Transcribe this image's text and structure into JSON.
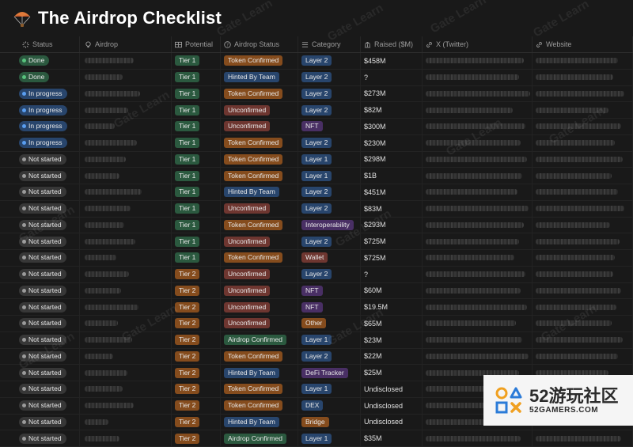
{
  "page": {
    "title": "The Airdrop Checklist"
  },
  "columns": {
    "status": "Status",
    "airdrop": "Airdrop",
    "potential": "Potential",
    "airdrop_status": "Airdrop Status",
    "category": "Category",
    "raised": "Raised ($M)",
    "x": "X (Twitter)",
    "website": "Website"
  },
  "colors": {
    "done": "#2b593f",
    "in_progress": "#28456c",
    "not_started": "#373737",
    "tier1": "#2b593f",
    "tier2": "#854c1d",
    "confirmed_brown": "#854c1d",
    "hinted_blue": "#28456c",
    "unconfirmed_red": "#6e3630",
    "airdrop_confirmed_green": "#2b593f",
    "layer_blue": "#28456c",
    "nft_purple": "#492f64",
    "wallet_red": "#6e3630",
    "other_brown": "#854c1d",
    "defi_purple": "#492f64",
    "bridge_brown": "#854c1d",
    "dex_blue": "#28456c"
  },
  "rows": [
    {
      "status": "Done",
      "potential": "Tier 1",
      "airdrop_status": "Token Confirmed",
      "category": "Layer 2",
      "raised": "$458M"
    },
    {
      "status": "Done",
      "potential": "Tier 1",
      "airdrop_status": "Hinted By Team",
      "category": "Layer 2",
      "raised": "?"
    },
    {
      "status": "In progress",
      "potential": "Tier 1",
      "airdrop_status": "Token Confirmed",
      "category": "Layer 2",
      "raised": "$273M"
    },
    {
      "status": "In progress",
      "potential": "Tier 1",
      "airdrop_status": "Unconfirmed",
      "category": "Layer 2",
      "raised": "$82M"
    },
    {
      "status": "In progress",
      "potential": "Tier 1",
      "airdrop_status": "Unconfirmed",
      "category": "NFT",
      "raised": "$300M"
    },
    {
      "status": "In progress",
      "potential": "Tier 1",
      "airdrop_status": "Token Confirmed",
      "category": "Layer 2",
      "raised": "$230M"
    },
    {
      "status": "Not started",
      "potential": "Tier 1",
      "airdrop_status": "Token Confirmed",
      "category": "Layer 1",
      "raised": "$298M"
    },
    {
      "status": "Not started",
      "potential": "Tier 1",
      "airdrop_status": "Token Confirmed",
      "category": "Layer 1",
      "raised": "$1B"
    },
    {
      "status": "Not started",
      "potential": "Tier 1",
      "airdrop_status": "Hinted By Team",
      "category": "Layer 2",
      "raised": "$451M"
    },
    {
      "status": "Not started",
      "potential": "Tier 1",
      "airdrop_status": "Unconfirmed",
      "category": "Layer 2",
      "raised": "$83M"
    },
    {
      "status": "Not started",
      "potential": "Tier 1",
      "airdrop_status": "Token Confirmed",
      "category": "Interoperability",
      "raised": "$293M"
    },
    {
      "status": "Not started",
      "potential": "Tier 1",
      "airdrop_status": "Unconfirmed",
      "category": "Layer 2",
      "raised": "$725M"
    },
    {
      "status": "Not started",
      "potential": "Tier 1",
      "airdrop_status": "Token Confirmed",
      "category": "Wallet",
      "raised": "$725M"
    },
    {
      "status": "Not started",
      "potential": "Tier 2",
      "airdrop_status": "Unconfirmed",
      "category": "Layer 2",
      "raised": "?"
    },
    {
      "status": "Not started",
      "potential": "Tier 2",
      "airdrop_status": "Unconfirmed",
      "category": "NFT",
      "raised": "$60M"
    },
    {
      "status": "Not started",
      "potential": "Tier 2",
      "airdrop_status": "Unconfirmed",
      "category": "NFT",
      "raised": "$19.5M"
    },
    {
      "status": "Not started",
      "potential": "Tier 2",
      "airdrop_status": "Unconfirmed",
      "category": "Other",
      "raised": "$65M"
    },
    {
      "status": "Not started",
      "potential": "Tier 2",
      "airdrop_status": "Airdrop Confirmed",
      "category": "Layer 1",
      "raised": "$23M"
    },
    {
      "status": "Not started",
      "potential": "Tier 2",
      "airdrop_status": "Token Confirmed",
      "category": "Layer 2",
      "raised": "$22M"
    },
    {
      "status": "Not started",
      "potential": "Tier 2",
      "airdrop_status": "Hinted By Team",
      "category": "DeFi Tracker",
      "raised": "$25M"
    },
    {
      "status": "Not started",
      "potential": "Tier 2",
      "airdrop_status": "Token Confirmed",
      "category": "Layer 1",
      "raised": "Undisclosed"
    },
    {
      "status": "Not started",
      "potential": "Tier 2",
      "airdrop_status": "Token Confirmed",
      "category": "DEX",
      "raised": "Undisclosed"
    },
    {
      "status": "Not started",
      "potential": "Tier 2",
      "airdrop_status": "Hinted By Team",
      "category": "Bridge",
      "raised": "Undisclosed"
    },
    {
      "status": "Not started",
      "potential": "Tier 2",
      "airdrop_status": "Airdrop Confirmed",
      "category": "Layer 1",
      "raised": "$35M"
    }
  ],
  "watermark": "Gate Learn",
  "logo": {
    "main": "52游玩社区",
    "sub": "52GAMERS.COM"
  }
}
